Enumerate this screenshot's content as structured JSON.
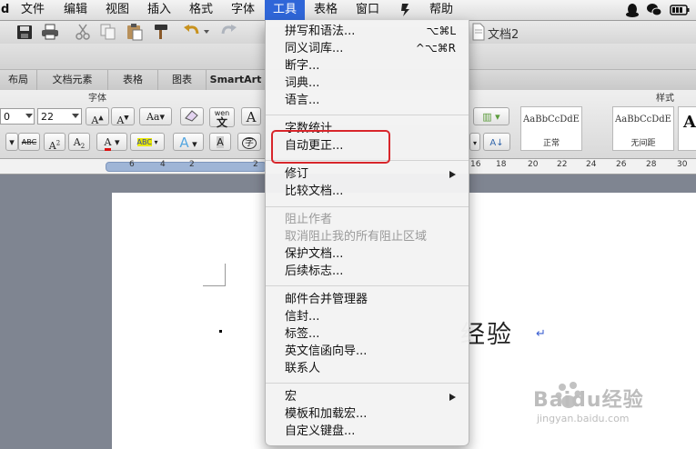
{
  "menubar": {
    "app_label": "d",
    "items": [
      "文件",
      "编辑",
      "视图",
      "插入",
      "格式",
      "字体",
      "工具",
      "表格",
      "窗口",
      "帮助"
    ],
    "active": "工具"
  },
  "window": {
    "doc_title": "文档2"
  },
  "ribbon": {
    "tabs": [
      "布局",
      "文档元素",
      "表格",
      "图表",
      "SmartArt"
    ],
    "font_group_label": "字体",
    "styles_group_label": "样式",
    "font_name_value": "0",
    "font_size_value": "22",
    "styles": [
      {
        "sample": "AaBbCcDdE",
        "name": "正常"
      },
      {
        "sample": "AaBbCcDdE",
        "name": "无间距"
      }
    ],
    "style_partial": "A"
  },
  "ruler": {
    "left_labels": [
      "6",
      "4",
      "2",
      "2"
    ],
    "right_labels": [
      "16",
      "18",
      "20",
      "22",
      "24",
      "26",
      "28",
      "30"
    ]
  },
  "document": {
    "visible_text": "经验",
    "return_mark": "↵"
  },
  "tools_menu": {
    "items": [
      {
        "label": "拼写和语法...",
        "shortcut": "⌥⌘L",
        "enabled": true
      },
      {
        "label": "同义词库...",
        "shortcut": "^⌥⌘R",
        "enabled": true
      },
      {
        "label": "断字...",
        "enabled": true
      },
      {
        "label": "词典...",
        "enabled": true
      },
      {
        "label": "语言...",
        "enabled": true
      },
      {
        "label": "字数统计...",
        "enabled": true
      },
      {
        "label": "自动更正...",
        "enabled": true,
        "highlighted": true
      },
      {
        "label": "修订",
        "submenu": true,
        "enabled": true
      },
      {
        "label": "比较文档...",
        "enabled": true
      },
      {
        "label": "阻止作者",
        "enabled": false
      },
      {
        "label": "取消阻止我的所有阻止区域",
        "enabled": false
      },
      {
        "label": "保护文档...",
        "enabled": true
      },
      {
        "label": "后续标志...",
        "enabled": true
      },
      {
        "label": "邮件合并管理器",
        "enabled": true
      },
      {
        "label": "信封...",
        "enabled": true
      },
      {
        "label": "标签...",
        "enabled": true
      },
      {
        "label": "英文信函向导...",
        "enabled": true
      },
      {
        "label": "联系人",
        "enabled": true
      },
      {
        "label": "宏",
        "submenu": true,
        "enabled": true
      },
      {
        "label": "模板和加载宏...",
        "enabled": true
      },
      {
        "label": "自定义键盘...",
        "enabled": true
      }
    ]
  },
  "watermark": {
    "brand": "Baidu经验",
    "url": "jingyan.baidu.com"
  },
  "colors": {
    "menu_highlight": "#2f66d8",
    "annotation_red": "#d8262b"
  }
}
